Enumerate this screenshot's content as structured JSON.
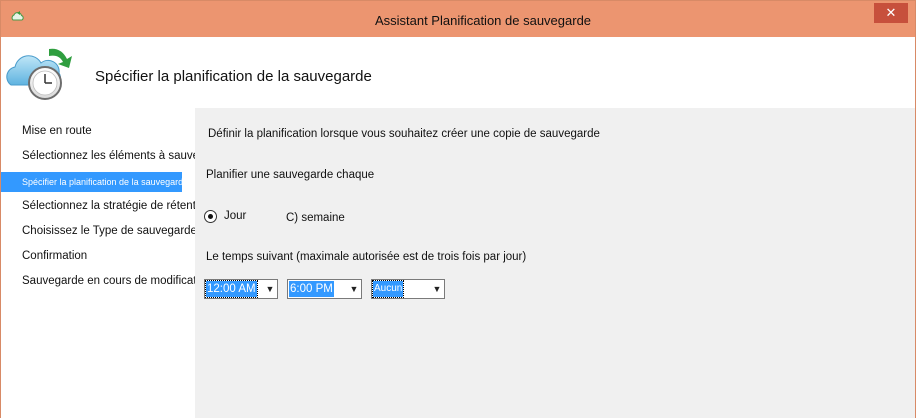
{
  "window": {
    "title": "Assistant Planification de sauvegarde",
    "close_glyph": "✕"
  },
  "header": {
    "title": "Spécifier la planification de la sauvegarde",
    "icon": "cloud-clock-backup-icon"
  },
  "sidebar": {
    "steps": [
      {
        "label": "Mise en route"
      },
      {
        "label": "Sélectionnez les éléments à sauvegarder"
      },
      {
        "label": "Spécifier la planification de la sauvegarde"
      },
      {
        "label": "Sélectionnez la stratégie de rétention"
      },
      {
        "label": "Choisissez le Type de sauvegarde Initial"
      },
      {
        "label": "Confirmation"
      },
      {
        "label": "Sauvegarde en cours de modification"
      }
    ],
    "active_index": 2
  },
  "main": {
    "intro": "Définir la planification lorsque vous souhaitez créer une copie de sauvegarde",
    "schedule_label": "Planifier une sauvegarde chaque",
    "options": [
      {
        "label": "Jour",
        "selected": true
      },
      {
        "label": "C) semaine",
        "selected": false
      }
    ],
    "times_label": "Le temps suivant (maximale autorisée est de trois fois par jour)",
    "time_selects": [
      {
        "value": "12:00 AM"
      },
      {
        "value": "6:00 PM"
      },
      {
        "value": "Aucun"
      }
    ]
  },
  "colors": {
    "titlebar": "#ec9570",
    "close": "#c7503c",
    "selection": "#3399ff"
  }
}
